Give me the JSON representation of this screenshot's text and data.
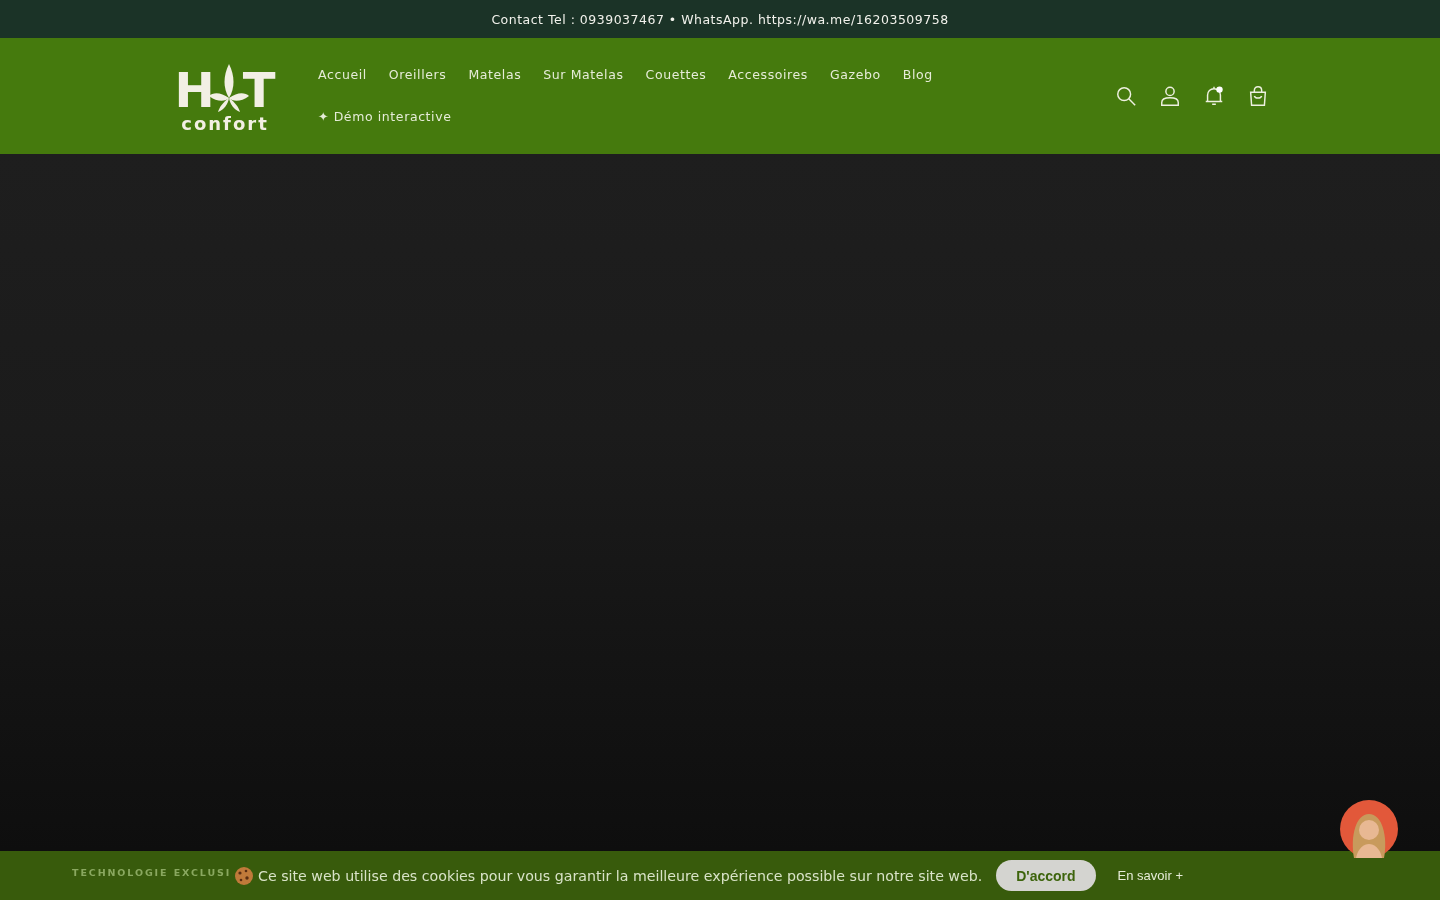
{
  "announcement": "Contact Tel : 0939037467 • WhatsApp. https://wa.me/16203509758",
  "logo": {
    "left": "H",
    "right": "T",
    "bottom": "confort"
  },
  "nav": [
    {
      "label": "Accueil"
    },
    {
      "label": "Oreillers"
    },
    {
      "label": "Matelas"
    },
    {
      "label": "Sur Matelas"
    },
    {
      "label": "Couettes"
    },
    {
      "label": "Accessoires"
    },
    {
      "label": "Gazebo"
    },
    {
      "label": "Blog"
    },
    {
      "label": "✦ Démo interactive"
    }
  ],
  "header_icons": [
    {
      "kind": "search"
    },
    {
      "kind": "account"
    },
    {
      "kind": "bell",
      "unread": true
    },
    {
      "kind": "cart"
    }
  ],
  "hero": {
    "eyebrow": "TECHNOLOGIE EXCLUSI"
  },
  "cookie_bar": {
    "text": "Ce site web utilise des cookies pour vous garantir la meilleure expérience possible sur notre site web.",
    "accept": "D'accord",
    "more": "En savoir +"
  }
}
